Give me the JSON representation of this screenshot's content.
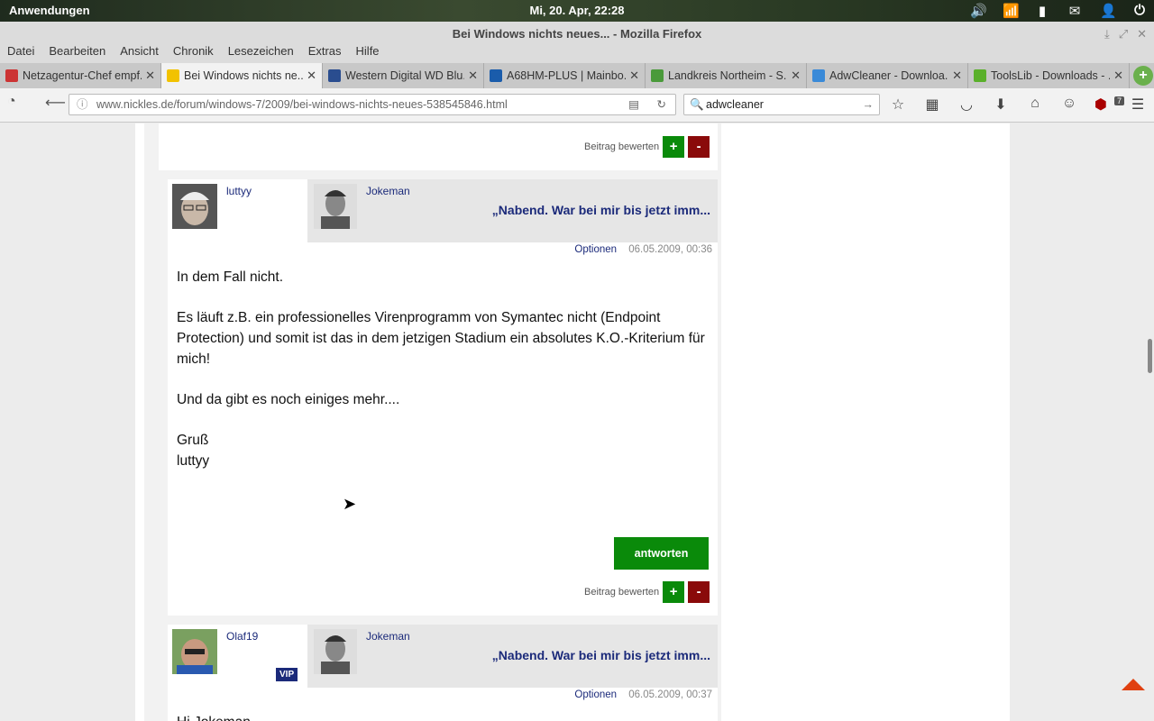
{
  "os": {
    "apps_label": "Anwendungen",
    "clock": "Mi, 20. Apr, 22:28",
    "tray_icons": [
      "volume-icon",
      "wifi-icon",
      "battery-icon",
      "mail-icon",
      "user-icon",
      "power-icon"
    ]
  },
  "window": {
    "title": "Bei Windows nichts neues... - Mozilla Firefox"
  },
  "menu": [
    "Datei",
    "Bearbeiten",
    "Ansicht",
    "Chronik",
    "Lesezeichen",
    "Extras",
    "Hilfe"
  ],
  "tabs": [
    {
      "label": "Netzagentur-Chef empf...",
      "color": "#c33"
    },
    {
      "label": "Bei Windows nichts ne...",
      "color": "#f2c200",
      "active": true
    },
    {
      "label": "Western Digital WD Blu...",
      "color": "#2a4d8f"
    },
    {
      "label": "A68HM-PLUS | Mainbo...",
      "color": "#1a5cab"
    },
    {
      "label": "Landkreis Northeim - S...",
      "color": "#4a9a3a"
    },
    {
      "label": "AdwCleaner - Downloa...",
      "color": "#3a8ad8"
    },
    {
      "label": "ToolsLib - Downloads - ...",
      "color": "#5ab02a"
    }
  ],
  "nav": {
    "url": "www.nickles.de/forum/windows-7/2009/bei-windows-nichts-neues-538545846.html",
    "search_value": "adwcleaner",
    "ublock_badge": "7"
  },
  "page": {
    "rate_label": "Beitrag bewerten",
    "plus": "+",
    "minus": "-",
    "reply_button": "antworten",
    "options_label": "Optionen",
    "post1": {
      "author": "luttyy",
      "reply_to": "Jokeman",
      "reply_title": "„Nabend. War bei mir bis jetzt imm...",
      "date": "06.05.2009, 00:36",
      "paragraphs": [
        "In dem Fall nicht.",
        "Es läuft z.B. ein professionelles Virenprogramm von Symantec nicht (Endpoint Protection) und somit ist das in dem jetzigen Stadium ein absolutes K.O.-Kriterium für mich!",
        "Und da gibt es noch einiges mehr....",
        "Gruß",
        "luttyy"
      ]
    },
    "post2": {
      "author": "Olaf19",
      "badge": "VIP",
      "reply_to": "Jokeman",
      "reply_title": "„Nabend. War bei mir bis jetzt imm...",
      "date": "06.05.2009, 00:37",
      "first_line": "Hi Jokeman,"
    }
  }
}
